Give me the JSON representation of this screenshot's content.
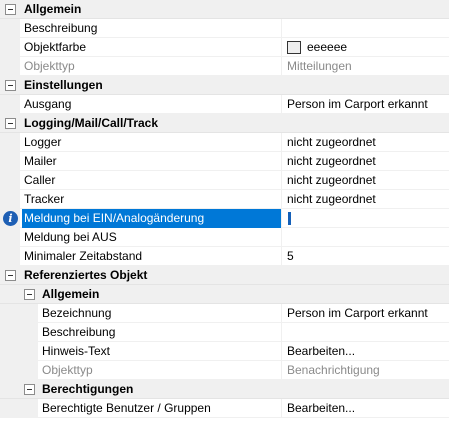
{
  "rows": [
    {
      "kind": "category",
      "level": 0,
      "label": "Allgemein"
    },
    {
      "kind": "property",
      "level": 0,
      "name": "Beschreibung",
      "value": ""
    },
    {
      "kind": "property",
      "level": 0,
      "name": "Objektfarbe",
      "value": "eeeeee",
      "swatch": "#eeeeee"
    },
    {
      "kind": "property",
      "level": 0,
      "name": "Objekttyp",
      "value": "Mitteilungen",
      "disabled": true
    },
    {
      "kind": "category",
      "level": 0,
      "label": "Einstellungen"
    },
    {
      "kind": "property",
      "level": 0,
      "name": "Ausgang",
      "value": "Person im Carport erkannt"
    },
    {
      "kind": "category",
      "level": 0,
      "label": "Logging/Mail/Call/Track"
    },
    {
      "kind": "property",
      "level": 0,
      "name": "Logger",
      "value": "nicht zugeordnet"
    },
    {
      "kind": "property",
      "level": 0,
      "name": "Mailer",
      "value": "nicht zugeordnet"
    },
    {
      "kind": "property",
      "level": 0,
      "name": "Caller",
      "value": "nicht zugeordnet"
    },
    {
      "kind": "property",
      "level": 0,
      "name": "Tracker",
      "value": "nicht zugeordnet"
    },
    {
      "kind": "property",
      "level": 0,
      "name": "Meldung bei EIN/Analogänderung",
      "value": "",
      "selected": true,
      "info": true
    },
    {
      "kind": "property",
      "level": 0,
      "name": "Meldung bei AUS",
      "value": ""
    },
    {
      "kind": "property",
      "level": 0,
      "name": "Minimaler Zeitabstand",
      "value": "5"
    },
    {
      "kind": "category",
      "level": 0,
      "label": "Referenziertes Objekt"
    },
    {
      "kind": "category",
      "level": 1,
      "label": "Allgemein"
    },
    {
      "kind": "property",
      "level": 1,
      "name": "Bezeichnung",
      "value": "Person im Carport erkannt"
    },
    {
      "kind": "property",
      "level": 1,
      "name": "Beschreibung",
      "value": ""
    },
    {
      "kind": "property",
      "level": 1,
      "name": "Hinweis-Text",
      "value": "Bearbeiten..."
    },
    {
      "kind": "property",
      "level": 1,
      "name": "Objekttyp",
      "value": "Benachrichtigung",
      "disabled": true
    },
    {
      "kind": "category",
      "level": 1,
      "label": "Berechtigungen"
    },
    {
      "kind": "property",
      "level": 1,
      "name": "Berechtigte Benutzer / Gruppen",
      "value": "Bearbeiten..."
    }
  ]
}
